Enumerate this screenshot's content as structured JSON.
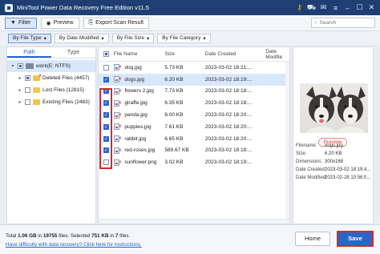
{
  "titlebar": {
    "title": "MiniTool Power Data Recovery Free Edition v11.5",
    "icons": [
      "key-icon",
      "cart-icon",
      "mail-icon",
      "menu-icon",
      "minimize-icon",
      "maximize-icon",
      "close-icon"
    ]
  },
  "toolbar": {
    "filter_label": "Filter",
    "preview_label": "Preview",
    "export_label": "Export Scan Result",
    "search_placeholder": "Search"
  },
  "filterbar": {
    "by_file_type": "By File Type",
    "by_date_modified": "By Date Modified",
    "by_file_size": "By File Size",
    "by_file_category": "By File Category"
  },
  "leftpanel": {
    "tabs": [
      "Path",
      "Type"
    ],
    "tree": [
      {
        "label": "work(E: NTFS)"
      },
      {
        "label": "Deleted Files (4457)"
      },
      {
        "label": "Lost Files (12815)"
      },
      {
        "label": "Existing Files (2483)"
      }
    ]
  },
  "filelist": {
    "headers": {
      "name": "File Name",
      "size": "Size",
      "created": "Date Created",
      "modified": "Date Modifie"
    },
    "rows": [
      {
        "name": "dog.jpg",
        "size": "5.73 KB",
        "created": "2023-03-02 18:21:..."
      },
      {
        "name": "dogs.jpg",
        "size": "6.20 KB",
        "created": "2023-03-02 18:19:..."
      },
      {
        "name": "flowers 2.jpg",
        "size": "7.73 KB",
        "created": "2023-03-02 18:18:..."
      },
      {
        "name": "giraffe.jpg",
        "size": "6.35 KB",
        "created": "2023-03-02 18:18:..."
      },
      {
        "name": "panda.jpg",
        "size": "8.00 KB",
        "created": "2023-03-02 18:20:..."
      },
      {
        "name": "puppies.jpg",
        "size": "7.61 KB",
        "created": "2023-03-02 18:20:..."
      },
      {
        "name": "rabbit.jpg",
        "size": "6.65 KB",
        "created": "2023-03-02 18:20:..."
      },
      {
        "name": "red-roses.jpg",
        "size": "589.67 KB",
        "created": "2023-03-02 18:18:..."
      },
      {
        "name": "sunflower.png",
        "size": "3.02 KB",
        "created": "2023-03-02 18:19:..."
      }
    ]
  },
  "preview": {
    "button_label": "Preview",
    "meta": [
      {
        "k": "Filename:",
        "v": "dogs.jpg"
      },
      {
        "k": "Size:",
        "v": "6.20 KB"
      },
      {
        "k": "Dimensions:",
        "v": "300x168"
      },
      {
        "k": "Date Created:",
        "v": "2023-03-02 18:19:4..."
      },
      {
        "k": "Date Modified:",
        "v": "2023-02-28 10:56:0..."
      }
    ]
  },
  "bottombar": {
    "summary_prefix": "Total ",
    "total_size": "1.06 GB",
    "summary_mid": " in ",
    "total_files": "19755",
    "summary_mid2": " files.  Selected ",
    "selected_size": "751 KB",
    "summary_mid3": " in ",
    "selected_files": "7",
    "summary_suffix": " files.",
    "help_link": "Have difficulty with data recovery? Click here for instructions.",
    "home_label": "Home",
    "save_label": "Save"
  },
  "colors": {
    "accent": "#2a66c9",
    "title_bg": "#1f3f72",
    "highlight_red": "#d8262b"
  }
}
